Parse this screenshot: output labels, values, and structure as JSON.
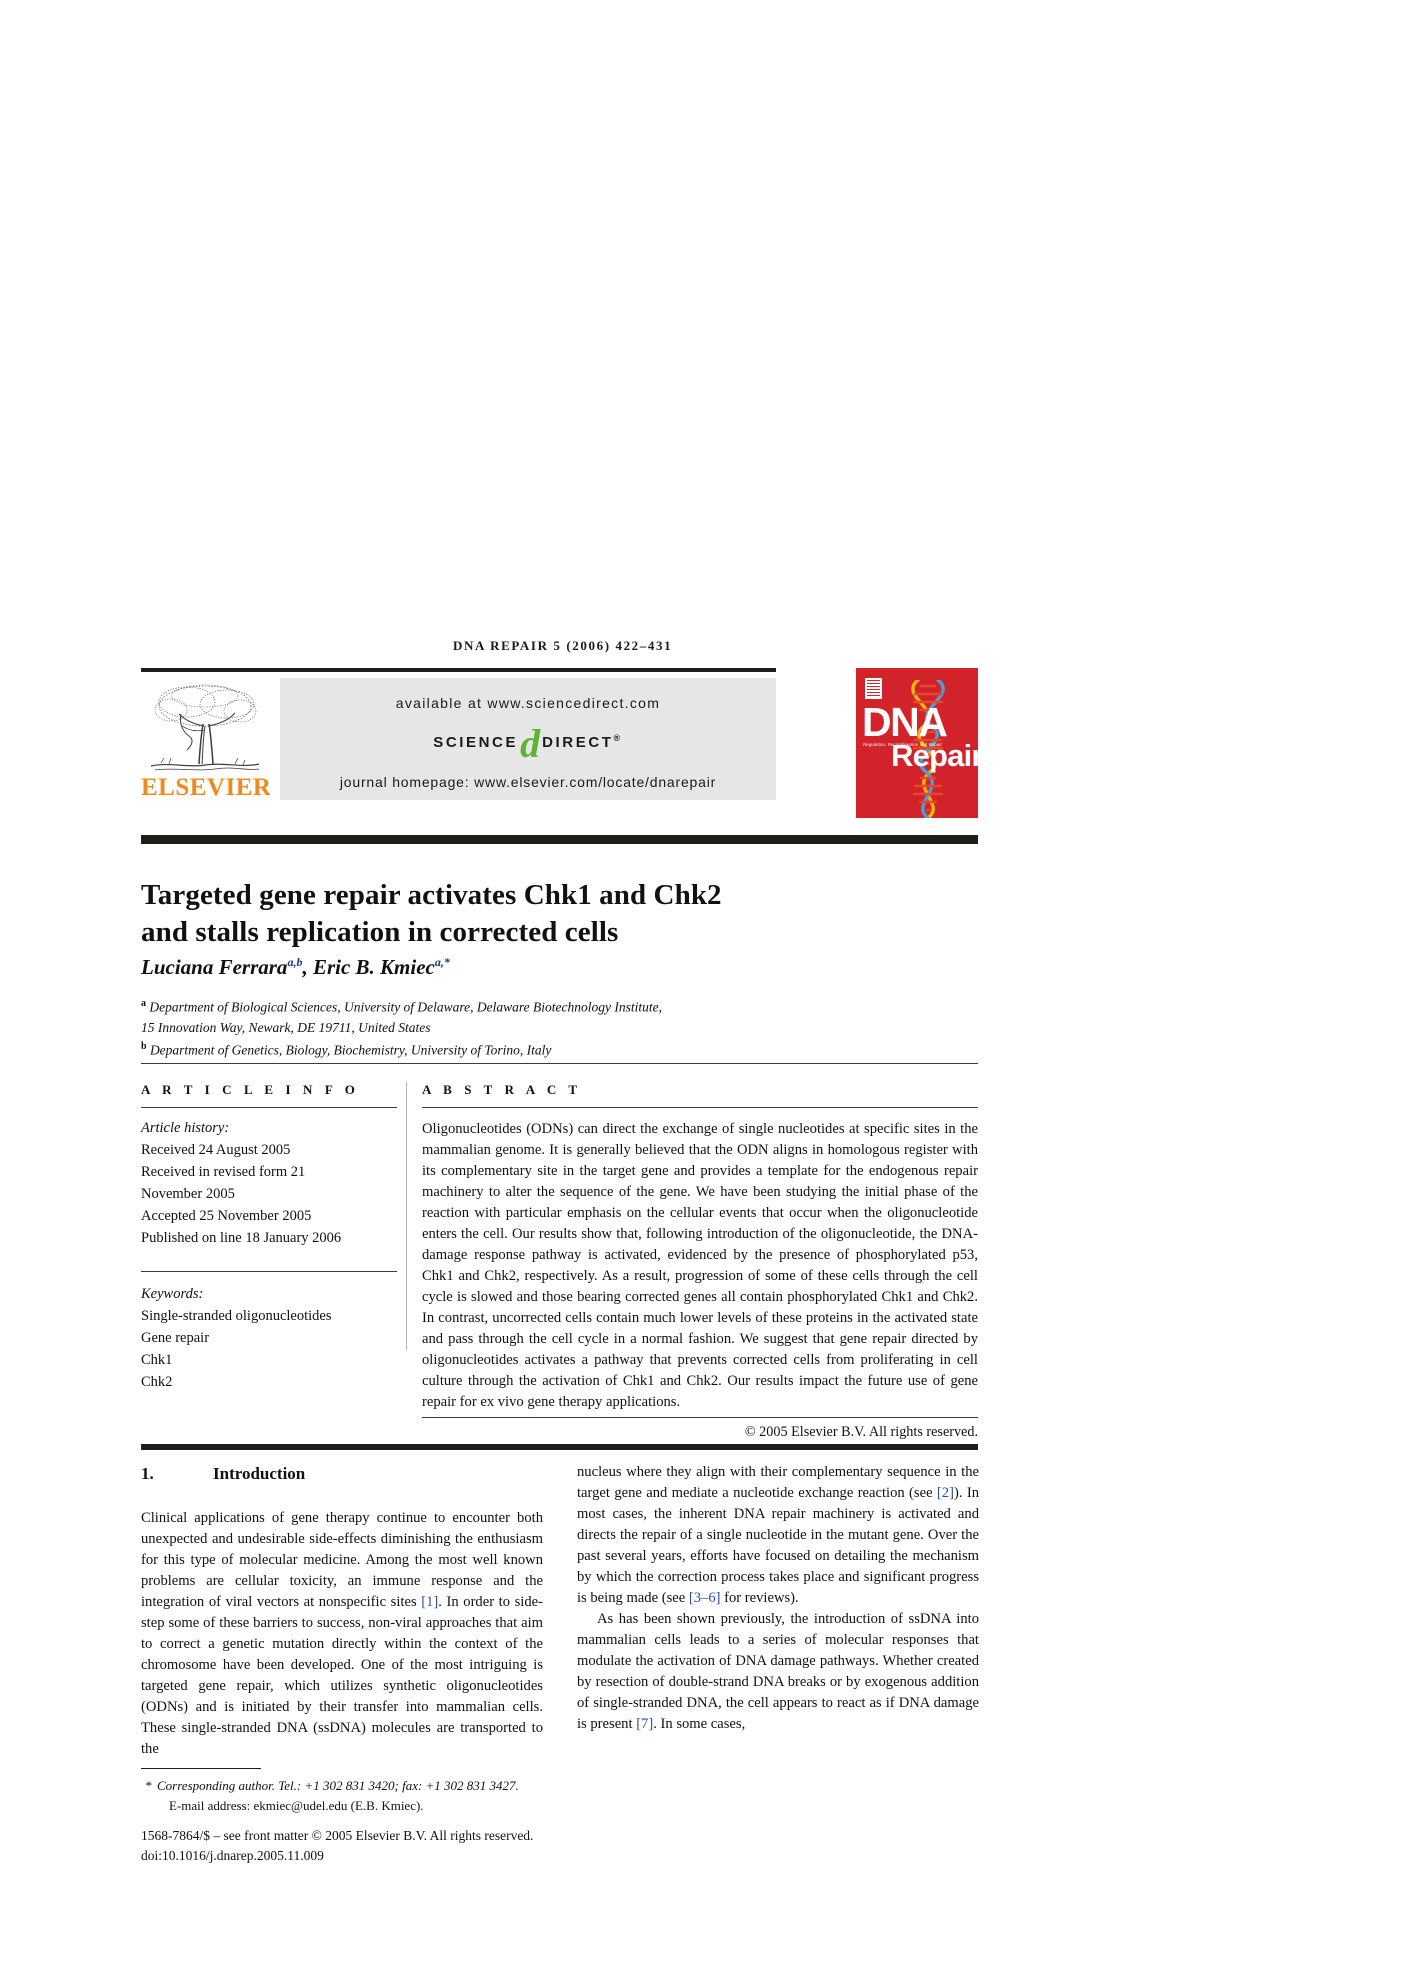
{
  "running_head": "DNA REPAIR 5 (2006) 422–431",
  "banner": {
    "publisher_name": "ELSEVIER",
    "tree_logo_alt": "elsevier-tree-logo",
    "available_at": "available at www.sciencedirect.com",
    "sciencedirect_left": "SCIENCE",
    "sciencedirect_d": "d",
    "sciencedirect_right": "DIRECT",
    "registered_mark": "®",
    "journal_homepage": "journal homepage: www.elsevier.com/locate/dnarepair"
  },
  "cover": {
    "title_line1": "DNA",
    "title_line2": "Repair",
    "subtitle": "Regulation, Recombination and Repair",
    "background_color": "#d2232a"
  },
  "article": {
    "title_line1": "Targeted gene repair activates Chk1 and Chk2",
    "title_line2": "and stalls replication in corrected cells",
    "authors_html": "Luciana Ferrara<sup>a,b</sup>, Eric B. Kmiec<sup>a,*</sup>",
    "affiliation_a_marker": "a",
    "affiliation_a_line1": "Department of Biological Sciences, University of Delaware, Delaware Biotechnology Institute,",
    "affiliation_a_line2": "15 Innovation Way, Newark, DE 19711, United States",
    "affiliation_b_marker": "b",
    "affiliation_b_line1": "Department of Genetics, Biology, Biochemistry, University of Torino, Italy"
  },
  "article_info": {
    "heading": "A R T I C L E  I N F O",
    "history_label": "Article history:",
    "history_lines": [
      "Received 24 August 2005",
      "Received in revised form 21",
      "November 2005",
      "Accepted 25 November 2005",
      "Published on line 18 January 2006"
    ],
    "keywords_label": "Keywords:",
    "keywords": [
      "Single-stranded oligonucleotides",
      "Gene repair",
      "Chk1",
      "Chk2"
    ]
  },
  "abstract": {
    "heading": "A B S T R A C T",
    "body": "Oligonucleotides (ODNs) can direct the exchange of single nucleotides at specific sites in the mammalian genome. It is generally believed that the ODN aligns in homologous register with its complementary site in the target gene and provides a template for the endogenous repair machinery to alter the sequence of the gene. We have been studying the initial phase of the reaction with particular emphasis on the cellular events that occur when the oligonucleotide enters the cell. Our results show that, following introduction of the oligonucleotide, the DNA-damage response pathway is activated, evidenced by the presence of phosphorylated p53, Chk1 and Chk2, respectively. As a result, progression of some of these cells through the cell cycle is slowed and those bearing corrected genes all contain phosphorylated Chk1 and Chk2. In contrast, uncorrected cells contain much lower levels of these proteins in the activated state and pass through the cell cycle in a normal fashion. We suggest that gene repair directed by oligonucleotides activates a pathway that prevents corrected cells from proliferating in cell culture through the activation of Chk1 and Chk2. Our results impact the future use of gene repair for ex vivo gene therapy applications.",
    "copyright": "© 2005 Elsevier B.V. All rights reserved."
  },
  "introduction": {
    "number": "1.",
    "heading": "Introduction",
    "left_paragraph_html": "Clinical applications of gene therapy continue to encounter both unexpected and undesirable side-effects diminishing the enthusiasm for this type of molecular medicine. Among the most well known problems are cellular toxicity, an immune response and the integration of viral vectors at nonspecific sites <span class=\"cite\">[1]</span>. In order to side-step some of these barriers to success, non-viral approaches that aim to correct a genetic mutation directly within the context of the chromosome have been developed. One of the most intriguing is targeted gene repair, which utilizes synthetic oligonucleotides (ODNs) and is initiated by their transfer into mammalian cells. These single-stranded DNA (ssDNA) molecules are transported to the",
    "right_paragraph1_html": "nucleus where they align with their complementary sequence in the target gene and mediate a nucleotide exchange reaction (see <span class=\"cite\">[2]</span>). In most cases, the inherent DNA repair machinery is activated and directs the repair of a single nucleotide in the mutant gene. Over the past several years, efforts have focused on detailing the mechanism by which the correction process takes place and significant progress is being made (see <span class=\"cite\">[3–6]</span> for reviews).",
    "right_paragraph2_html": "As has been shown previously, the introduction of ssDNA into mammalian cells leads to a series of molecular responses that modulate the activation of DNA damage pathways. Whether created by resection of double-strand DNA breaks or by exogenous addition of single-stranded DNA, the cell appears to react as if DNA damage is present <span class=\"cite\">[7]</span>. In some cases,"
  },
  "footnotes": {
    "corresponding_marker": "*",
    "corresponding_author": "Corresponding author. Tel.: +1 302 831 3420; fax: +1 302 831 3427.",
    "email_address": "E-mail address: ekmiec@udel.edu (E.B. Kmiec).",
    "front_matter": "1568-7864/$ – see front matter © 2005 Elsevier B.V. All rights reserved.",
    "doi": "doi:10.1016/j.dnarep.2005.11.009"
  },
  "colors": {
    "elsevier_orange": "#f08a1e",
    "sciencedirect_green": "#5bb531",
    "citation_blue": "#2b4ea2",
    "cover_red": "#d2232a"
  }
}
